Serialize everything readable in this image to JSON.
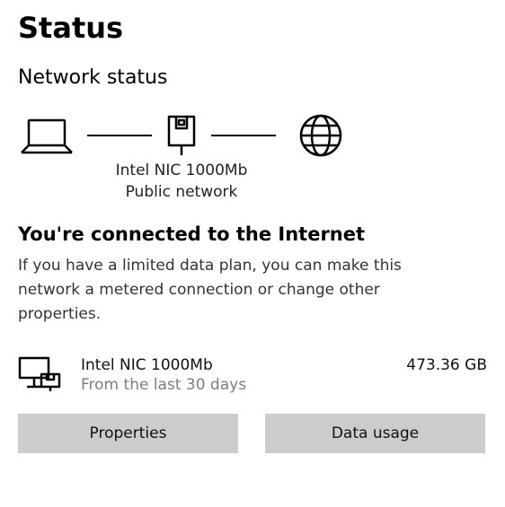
{
  "page": {
    "title": "Status"
  },
  "section": {
    "title": "Network status"
  },
  "diagram": {
    "pc_icon": "laptop-icon",
    "router_icon": "router-icon",
    "globe_icon": "globe-icon",
    "router_name": "Intel NIC 1000Mb",
    "network_type": "Public network"
  },
  "status": {
    "headline": "You're connected to the Internet",
    "description": "If you have a limited data plan, you can make this network a metered connection or change other properties."
  },
  "adapter": {
    "icon": "ethernet-adapter-icon",
    "name": "Intel NIC 1000Mb",
    "period": "From the last 30 days",
    "usage": "473.36 GB"
  },
  "buttons": {
    "properties": "Properties",
    "data_usage": "Data usage"
  }
}
